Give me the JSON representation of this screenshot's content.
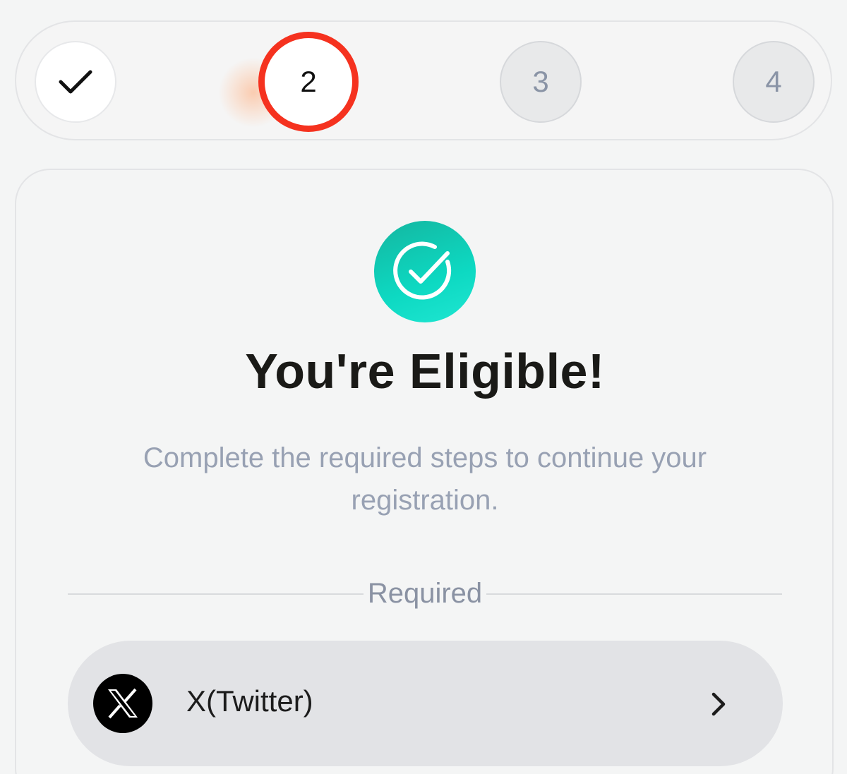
{
  "stepper": {
    "steps": [
      {
        "label": "",
        "state": "completed",
        "icon": "check-icon"
      },
      {
        "label": "2",
        "state": "active"
      },
      {
        "label": "3",
        "state": "pending"
      },
      {
        "label": "4",
        "state": "pending"
      }
    ],
    "active_color": "#f5321f"
  },
  "card": {
    "badge_icon": "check-circle-icon",
    "badge_color": "#0dd9c2",
    "title": "You're Eligible!",
    "subtitle": "Complete the required steps to continue your registration.",
    "section_label": "Required",
    "tasks": [
      {
        "label": "X(Twitter)",
        "icon": "x-logo-icon",
        "action_icon": "chevron-right-icon"
      }
    ]
  }
}
